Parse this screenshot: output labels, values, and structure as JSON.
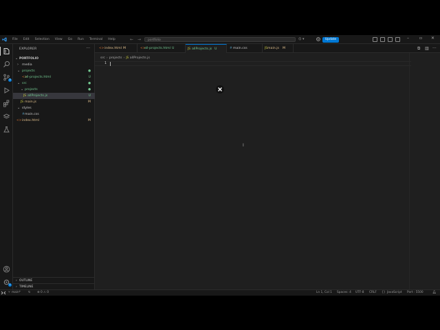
{
  "titlebar": {
    "menu": [
      "File",
      "Edit",
      "Selection",
      "View",
      "Go",
      "Run",
      "Terminal",
      "Help"
    ],
    "command_center": "portfolio",
    "update_label": "Update"
  },
  "sidebar": {
    "title": "EXPLORER",
    "root": "PORTFOLIO",
    "tree": [
      {
        "label": "media",
        "kind": "folder",
        "open": false,
        "depth": 0,
        "status": ""
      },
      {
        "label": "projects",
        "kind": "folder",
        "open": true,
        "depth": 0,
        "status": "●"
      },
      {
        "label": "all-projects.html",
        "kind": "html",
        "depth": 1,
        "status": "U"
      },
      {
        "label": "src",
        "kind": "folder",
        "open": true,
        "depth": 0,
        "status": "●"
      },
      {
        "label": "projects",
        "kind": "folder",
        "open": true,
        "depth": 1,
        "status": "●"
      },
      {
        "label": "allProjects.js",
        "kind": "js",
        "depth": 2,
        "status": "U",
        "selected": true
      },
      {
        "label": "main.js",
        "kind": "js",
        "depth": 1,
        "status": "M"
      },
      {
        "label": "styles",
        "kind": "folder",
        "open": true,
        "depth": 0,
        "status": ""
      },
      {
        "label": "main.css",
        "kind": "css",
        "depth": 1,
        "status": ""
      },
      {
        "label": "index.html",
        "kind": "html",
        "depth": 0,
        "status": "M"
      }
    ],
    "outline": "OUTLINE",
    "timeline": "TIMELINE"
  },
  "tabs": [
    {
      "label": "index.html",
      "status": "M",
      "icon": "html-icon"
    },
    {
      "label": "all-projects.html",
      "status": "U",
      "icon": "html-icon"
    },
    {
      "label": "allProjects.js",
      "status": "U",
      "icon": "js-icon",
      "active": true
    },
    {
      "label": "main.css",
      "status": "",
      "icon": "css-icon"
    },
    {
      "label": "main.js",
      "status": "M",
      "icon": "js-icon"
    }
  ],
  "breadcrumb": [
    "src",
    "projects",
    "allProjects.js"
  ],
  "editor": {
    "line_numbers": [
      "1"
    ]
  },
  "statusbar": {
    "branch": "main*",
    "problems": "⊗ 0 ⚠ 0",
    "position": "Ln 1, Col 1",
    "spaces": "Spaces: 4",
    "encoding": "UTF-8",
    "eol": "CRLF",
    "language": "JavaScript",
    "port": "Port : 5500"
  },
  "colors": {
    "accent": "#0078d4",
    "untracked": "#73c991",
    "modified": "#e2c08d",
    "background": "#1f1f1f",
    "sidebar": "#181818"
  }
}
